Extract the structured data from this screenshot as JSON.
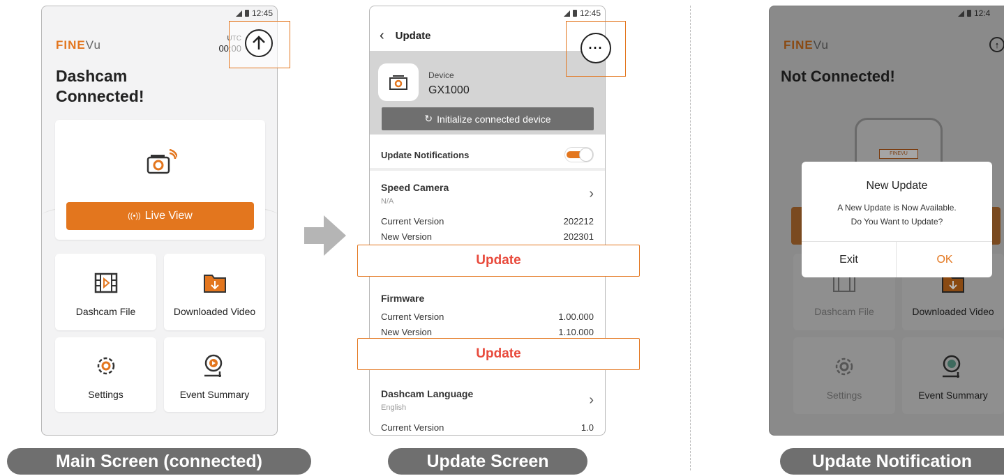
{
  "status_time": "12:45",
  "brand": {
    "fine": "FINE",
    "vu": "Vu"
  },
  "main": {
    "utc_label": "UTC",
    "utc_time": "00:00",
    "title_line1": "Dashcam",
    "title_line2": "Connected!",
    "live_view": "Live View",
    "tiles": [
      "Dashcam File",
      "Downloaded Video",
      "Settings",
      "Event Summary"
    ]
  },
  "update_screen": {
    "back": "<",
    "title": "Update",
    "device_label": "Device",
    "device_name": "GX1000",
    "init_button": "Initialize connected device",
    "notifications_label": "Update Notifications",
    "notifications_on": true,
    "speed_camera": {
      "label": "Speed Camera",
      "sub": "N/A",
      "current_label": "Current Version",
      "current": "202212",
      "new_label": "New Version",
      "new": "202301"
    },
    "update_button": "Update",
    "firmware": {
      "label": "Firmware",
      "current_label": "Current Version",
      "current": "1.00.000",
      "new_label": "New Version",
      "new": "1.10.000"
    },
    "language": {
      "label": "Dashcam Language",
      "sub": "English",
      "current_label": "Current Version",
      "current": "1.0"
    }
  },
  "notification_screen": {
    "status_time": "12:4",
    "title": "Not Connected!",
    "dialog_title": "New Update",
    "dialog_line1": "A New Update is Now Available.",
    "dialog_line2": "Do You Want to Update?",
    "exit": "Exit",
    "ok": "OK",
    "plate": "FINEVU",
    "tiles": [
      "Dashcam File",
      "Downloaded Video",
      "Settings",
      "Event Summary"
    ]
  },
  "captions": [
    "Main Screen (connected)",
    "Update Screen",
    "Update Notification"
  ],
  "colors": {
    "accent": "#e3761e",
    "update_red": "#e84a3c",
    "caption_bg": "#6f6f6f"
  }
}
